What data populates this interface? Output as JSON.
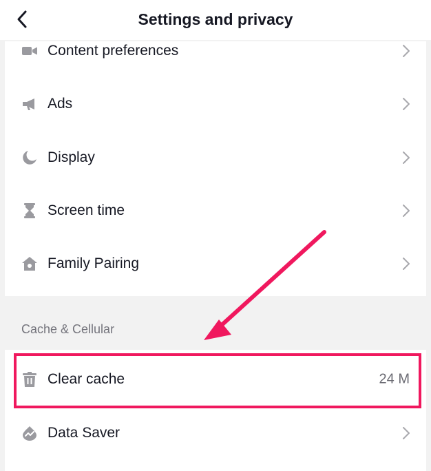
{
  "header": {
    "title": "Settings and privacy",
    "back_icon": "chevron-left-icon"
  },
  "settings_items": [
    {
      "label": "Content preferences",
      "icon": "video-camera-icon"
    },
    {
      "label": "Ads",
      "icon": "megaphone-icon"
    },
    {
      "label": "Display",
      "icon": "moon-icon"
    },
    {
      "label": "Screen time",
      "icon": "hourglass-icon"
    },
    {
      "label": "Family Pairing",
      "icon": "home-icon"
    }
  ],
  "cache_section": {
    "title": "Cache & Cellular",
    "items": [
      {
        "label": "Clear cache",
        "icon": "trash-icon",
        "value": "24 M"
      },
      {
        "label": "Data Saver",
        "icon": "data-saver-icon"
      }
    ]
  },
  "colors": {
    "annotation": "#f0185e",
    "icon": "#9a9a9f",
    "chevron": "#a8a8ad",
    "text": "#161823",
    "section_title": "#75757d"
  }
}
